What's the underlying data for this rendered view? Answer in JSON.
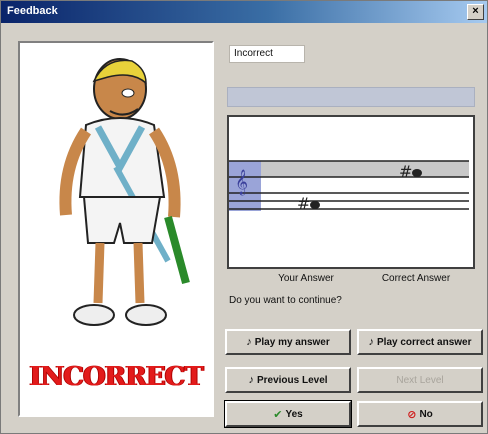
{
  "window": {
    "title": "Feedback",
    "close_glyph": "×"
  },
  "image": {
    "stamp_text": "INCORRECT",
    "icon": "cartoon-tennis-player"
  },
  "feedback": {
    "label": "Incorrect",
    "bar_text": ""
  },
  "staff": {
    "notes": [
      {
        "name": "your-note",
        "accidental": "#"
      },
      {
        "name": "correct-note",
        "accidental": "#"
      }
    ],
    "captions": {
      "your_answer": "Your Answer",
      "correct_answer": "Correct Answer"
    }
  },
  "question": "Do you want to continue?",
  "buttons": {
    "play_my_answer": "Play my answer",
    "play_correct": "Play correct answer",
    "previous_level": "Previous Level",
    "next_level": "Next Level",
    "yes": "Yes",
    "no": "No"
  },
  "colors": {
    "stamp": "#e21b1b",
    "title_bar": "#0a246a",
    "highlight": "#9aa4d8"
  }
}
